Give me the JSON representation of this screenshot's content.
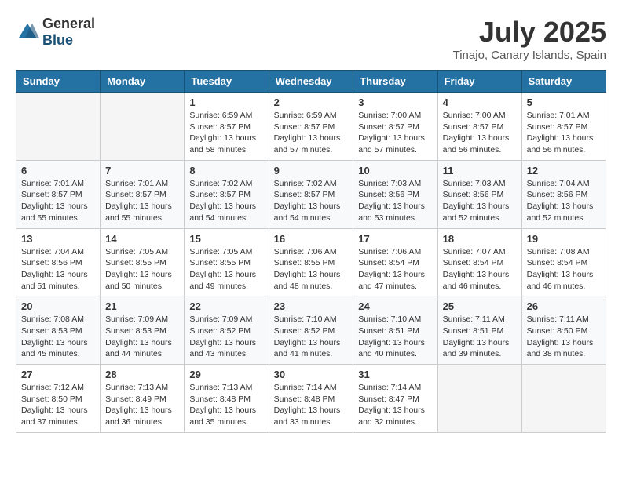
{
  "header": {
    "logo_general": "General",
    "logo_blue": "Blue",
    "month_year": "July 2025",
    "location": "Tinajo, Canary Islands, Spain"
  },
  "weekdays": [
    "Sunday",
    "Monday",
    "Tuesday",
    "Wednesday",
    "Thursday",
    "Friday",
    "Saturday"
  ],
  "weeks": [
    [
      {
        "day": "",
        "empty": true
      },
      {
        "day": "",
        "empty": true
      },
      {
        "day": "1",
        "sunrise": "6:59 AM",
        "sunset": "8:57 PM",
        "daylight": "13 hours and 58 minutes."
      },
      {
        "day": "2",
        "sunrise": "6:59 AM",
        "sunset": "8:57 PM",
        "daylight": "13 hours and 57 minutes."
      },
      {
        "day": "3",
        "sunrise": "7:00 AM",
        "sunset": "8:57 PM",
        "daylight": "13 hours and 57 minutes."
      },
      {
        "day": "4",
        "sunrise": "7:00 AM",
        "sunset": "8:57 PM",
        "daylight": "13 hours and 56 minutes."
      },
      {
        "day": "5",
        "sunrise": "7:01 AM",
        "sunset": "8:57 PM",
        "daylight": "13 hours and 56 minutes."
      }
    ],
    [
      {
        "day": "6",
        "sunrise": "7:01 AM",
        "sunset": "8:57 PM",
        "daylight": "13 hours and 55 minutes."
      },
      {
        "day": "7",
        "sunrise": "7:01 AM",
        "sunset": "8:57 PM",
        "daylight": "13 hours and 55 minutes."
      },
      {
        "day": "8",
        "sunrise": "7:02 AM",
        "sunset": "8:57 PM",
        "daylight": "13 hours and 54 minutes."
      },
      {
        "day": "9",
        "sunrise": "7:02 AM",
        "sunset": "8:57 PM",
        "daylight": "13 hours and 54 minutes."
      },
      {
        "day": "10",
        "sunrise": "7:03 AM",
        "sunset": "8:56 PM",
        "daylight": "13 hours and 53 minutes."
      },
      {
        "day": "11",
        "sunrise": "7:03 AM",
        "sunset": "8:56 PM",
        "daylight": "13 hours and 52 minutes."
      },
      {
        "day": "12",
        "sunrise": "7:04 AM",
        "sunset": "8:56 PM",
        "daylight": "13 hours and 52 minutes."
      }
    ],
    [
      {
        "day": "13",
        "sunrise": "7:04 AM",
        "sunset": "8:56 PM",
        "daylight": "13 hours and 51 minutes."
      },
      {
        "day": "14",
        "sunrise": "7:05 AM",
        "sunset": "8:55 PM",
        "daylight": "13 hours and 50 minutes."
      },
      {
        "day": "15",
        "sunrise": "7:05 AM",
        "sunset": "8:55 PM",
        "daylight": "13 hours and 49 minutes."
      },
      {
        "day": "16",
        "sunrise": "7:06 AM",
        "sunset": "8:55 PM",
        "daylight": "13 hours and 48 minutes."
      },
      {
        "day": "17",
        "sunrise": "7:06 AM",
        "sunset": "8:54 PM",
        "daylight": "13 hours and 47 minutes."
      },
      {
        "day": "18",
        "sunrise": "7:07 AM",
        "sunset": "8:54 PM",
        "daylight": "13 hours and 46 minutes."
      },
      {
        "day": "19",
        "sunrise": "7:08 AM",
        "sunset": "8:54 PM",
        "daylight": "13 hours and 46 minutes."
      }
    ],
    [
      {
        "day": "20",
        "sunrise": "7:08 AM",
        "sunset": "8:53 PM",
        "daylight": "13 hours and 45 minutes."
      },
      {
        "day": "21",
        "sunrise": "7:09 AM",
        "sunset": "8:53 PM",
        "daylight": "13 hours and 44 minutes."
      },
      {
        "day": "22",
        "sunrise": "7:09 AM",
        "sunset": "8:52 PM",
        "daylight": "13 hours and 43 minutes."
      },
      {
        "day": "23",
        "sunrise": "7:10 AM",
        "sunset": "8:52 PM",
        "daylight": "13 hours and 41 minutes."
      },
      {
        "day": "24",
        "sunrise": "7:10 AM",
        "sunset": "8:51 PM",
        "daylight": "13 hours and 40 minutes."
      },
      {
        "day": "25",
        "sunrise": "7:11 AM",
        "sunset": "8:51 PM",
        "daylight": "13 hours and 39 minutes."
      },
      {
        "day": "26",
        "sunrise": "7:11 AM",
        "sunset": "8:50 PM",
        "daylight": "13 hours and 38 minutes."
      }
    ],
    [
      {
        "day": "27",
        "sunrise": "7:12 AM",
        "sunset": "8:50 PM",
        "daylight": "13 hours and 37 minutes."
      },
      {
        "day": "28",
        "sunrise": "7:13 AM",
        "sunset": "8:49 PM",
        "daylight": "13 hours and 36 minutes."
      },
      {
        "day": "29",
        "sunrise": "7:13 AM",
        "sunset": "8:48 PM",
        "daylight": "13 hours and 35 minutes."
      },
      {
        "day": "30",
        "sunrise": "7:14 AM",
        "sunset": "8:48 PM",
        "daylight": "13 hours and 33 minutes."
      },
      {
        "day": "31",
        "sunrise": "7:14 AM",
        "sunset": "8:47 PM",
        "daylight": "13 hours and 32 minutes."
      },
      {
        "day": "",
        "empty": true
      },
      {
        "day": "",
        "empty": true
      }
    ]
  ]
}
